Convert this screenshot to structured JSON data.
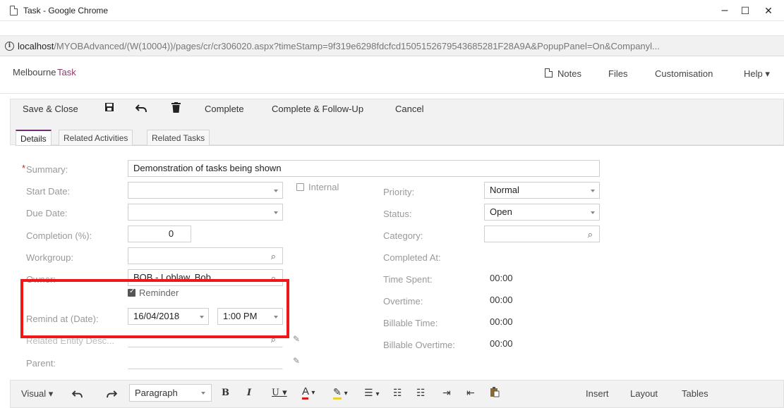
{
  "window": {
    "title": "Task - Google Chrome",
    "minimize": "–",
    "maximize": "☐",
    "close": "✕"
  },
  "address": {
    "host": "localhost",
    "path": "/MYOBAdvanced/(W(10004))/pages/cr/cr306020.aspx?timeStamp=9f319e6298fdcfcd1505152679543685281F28A9A&PopupPanel=On&Companyl..."
  },
  "header": {
    "company": "Melbourne",
    "screen": "Task",
    "notes": "Notes",
    "files": "Files",
    "customisation": "Customisation",
    "help": "Help ▾"
  },
  "toolbar": {
    "save_close": "Save & Close",
    "save_icon": "floppy-disk",
    "undo_icon": "undo",
    "delete_icon": "trash",
    "complete": "Complete",
    "complete_follow": "Complete & Follow-Up",
    "cancel": "Cancel"
  },
  "tabs": [
    "Details",
    "Related Activities",
    "Related Tasks"
  ],
  "form": {
    "summary_label": "Summary:",
    "summary_value": "Demonstration of tasks being shown",
    "start_date_label": "Start Date:",
    "start_date_value": "",
    "internal_label": "Internal",
    "due_date_label": "Due Date:",
    "due_date_value": "",
    "completion_label": "Completion (%):",
    "completion_value": "0",
    "workgroup_label": "Workgroup:",
    "workgroup_value": "",
    "owner_label": "Owner:",
    "owner_value": "BOB - Loblaw, Bob",
    "reminder_label": "Reminder",
    "reminder_checked": true,
    "remind_at_label": "Remind at (Date):",
    "remind_date": "16/04/2018",
    "remind_time": "1:00 PM",
    "related_entity_label": "Related Entity Desc...",
    "related_entity_value": "",
    "parent_label": "Parent:",
    "parent_value": "",
    "priority_label": "Priority:",
    "priority_value": "Normal",
    "status_label": "Status:",
    "status_value": "Open",
    "category_label": "Category:",
    "category_value": "",
    "completed_at_label": "Completed At:",
    "time_spent_label": "Time Spent:",
    "time_spent_value": "00:00",
    "overtime_label": "Overtime:",
    "overtime_value": "00:00",
    "billable_time_label": "Billable Time:",
    "billable_time_value": "00:00",
    "billable_overtime_label": "Billable Overtime:",
    "billable_overtime_value": "00:00"
  },
  "editor": {
    "visual": "Visual ▾",
    "paragraph": "Paragraph",
    "insert": "Insert",
    "layout": "Layout",
    "tables": "Tables"
  },
  "colors": {
    "accent": "#6f2f73",
    "screen_title": "#8a3e6b",
    "highlight": "#ef1717",
    "required": "#d01f1f"
  }
}
